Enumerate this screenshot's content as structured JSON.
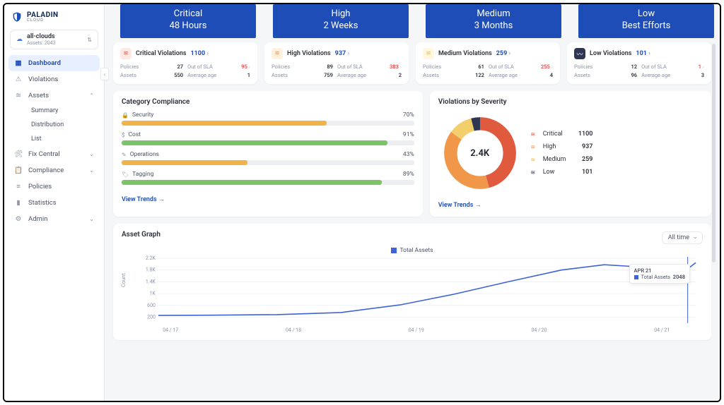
{
  "brand": {
    "name": "PALADIN",
    "sub": "CLOUD"
  },
  "overlay": [
    {
      "title": "Critical",
      "sla": "48 Hours"
    },
    {
      "title": "High",
      "sla": "2 Weeks"
    },
    {
      "title": "Medium",
      "sla": "3 Months"
    },
    {
      "title": "Low",
      "sla": "Best Efforts"
    }
  ],
  "scope": {
    "label": "all-clouds",
    "assets_label": "Assets: 2043"
  },
  "sidebar": {
    "items": [
      {
        "label": "Dashboard",
        "icon": "grid",
        "active": true
      },
      {
        "label": "Violations",
        "icon": "alert"
      },
      {
        "label": "Assets",
        "icon": "layers",
        "expandable": true,
        "expanded": true,
        "children": [
          {
            "label": "Summary"
          },
          {
            "label": "Distribution"
          },
          {
            "label": "List"
          }
        ]
      },
      {
        "label": "Fix Central",
        "icon": "wrench",
        "expandable": true
      },
      {
        "label": "Compliance",
        "icon": "clipboard",
        "expandable": true
      },
      {
        "label": "Policies",
        "icon": "lines"
      },
      {
        "label": "Statistics",
        "icon": "bars"
      },
      {
        "label": "Admin",
        "icon": "gear",
        "expandable": true
      }
    ]
  },
  "kpi": [
    {
      "title": "Critical Violations",
      "count": "1100",
      "color": "red",
      "policies_lbl": "Policies",
      "policies": "27",
      "out_lbl": "Out of SLA",
      "out": "95",
      "assets_lbl": "Assets",
      "assets": "550",
      "age_lbl": "Average age",
      "age": "1"
    },
    {
      "title": "High Violations",
      "count": "937",
      "color": "orange",
      "policies_lbl": "Policies",
      "policies": "89",
      "out_lbl": "Out of SLA",
      "out": "383",
      "assets_lbl": "Assets",
      "assets": "759",
      "age_lbl": "Average age",
      "age": "2"
    },
    {
      "title": "Medium Violations",
      "count": "259",
      "color": "yellow",
      "policies_lbl": "Policies",
      "policies": "61",
      "out_lbl": "Out of SLA",
      "out": "255",
      "assets_lbl": "Assets",
      "assets": "122",
      "age_lbl": "Average age",
      "age": "4"
    },
    {
      "title": "Low Violations",
      "count": "101",
      "color": "blue",
      "policies_lbl": "Policies",
      "policies": "12",
      "out_lbl": "Out of SLA",
      "out": "1",
      "assets_lbl": "Assets",
      "assets": "96",
      "age_lbl": "Average age",
      "age": "3"
    }
  ],
  "compliance": {
    "title": "Category Compliance",
    "rows": [
      {
        "icon": "lock",
        "label": "Security",
        "pct": 70,
        "color": "orange"
      },
      {
        "icon": "dollar",
        "label": "Cost",
        "pct": 91,
        "color": "green"
      },
      {
        "icon": "ops",
        "label": "Operations",
        "pct": 43,
        "color": "orange"
      },
      {
        "icon": "tag",
        "label": "Tagging",
        "pct": 89,
        "color": "green"
      }
    ],
    "view_trends": "View Trends"
  },
  "severity": {
    "title": "Violations by Severity",
    "total_label": "2.4K",
    "items": [
      {
        "label": "Critical",
        "count": "1100",
        "color": "red"
      },
      {
        "label": "High",
        "count": "937",
        "color": "orange"
      },
      {
        "label": "Medium",
        "count": "259",
        "color": "yellow"
      },
      {
        "label": "Low",
        "count": "101",
        "color": "blue"
      }
    ],
    "view_trends": "View Trends"
  },
  "asset_graph": {
    "title": "Asset Graph",
    "time_selector": "All time",
    "legend": "Total Assets",
    "ylabel": "Count",
    "tooltip": {
      "date": "APR 21",
      "label": "Total Assets",
      "value": "2048"
    }
  },
  "chart_data": {
    "type": "line",
    "xlabel": "",
    "ylabel": "Count",
    "ylim": [
      0,
      2200
    ],
    "y_ticks": [
      200,
      600,
      1000,
      1400,
      1800,
      2200
    ],
    "x_ticks": [
      "04 / 17",
      "04 / 18",
      "04 / 19",
      "04 / 20",
      "04 / 21"
    ],
    "series": [
      {
        "name": "Total Assets",
        "x": [
          0,
          0.1,
          0.22,
          0.34,
          0.45,
          0.55,
          0.65,
          0.75,
          0.83,
          0.9,
          0.96,
          0.985,
          1.0
        ],
        "values": [
          260,
          270,
          290,
          360,
          620,
          980,
          1400,
          1800,
          1980,
          1900,
          1820,
          1840,
          2050
        ]
      }
    ]
  },
  "colors": {
    "critical": "#e05a3d",
    "high": "#f0974a",
    "medium": "#f2cf6b",
    "low": "#2e3652",
    "green": "#7cc36a",
    "orange": "#f0b24a",
    "line": "#3d63d6",
    "accent": "#1e4db7"
  },
  "icons": {
    "layers": "≋"
  }
}
